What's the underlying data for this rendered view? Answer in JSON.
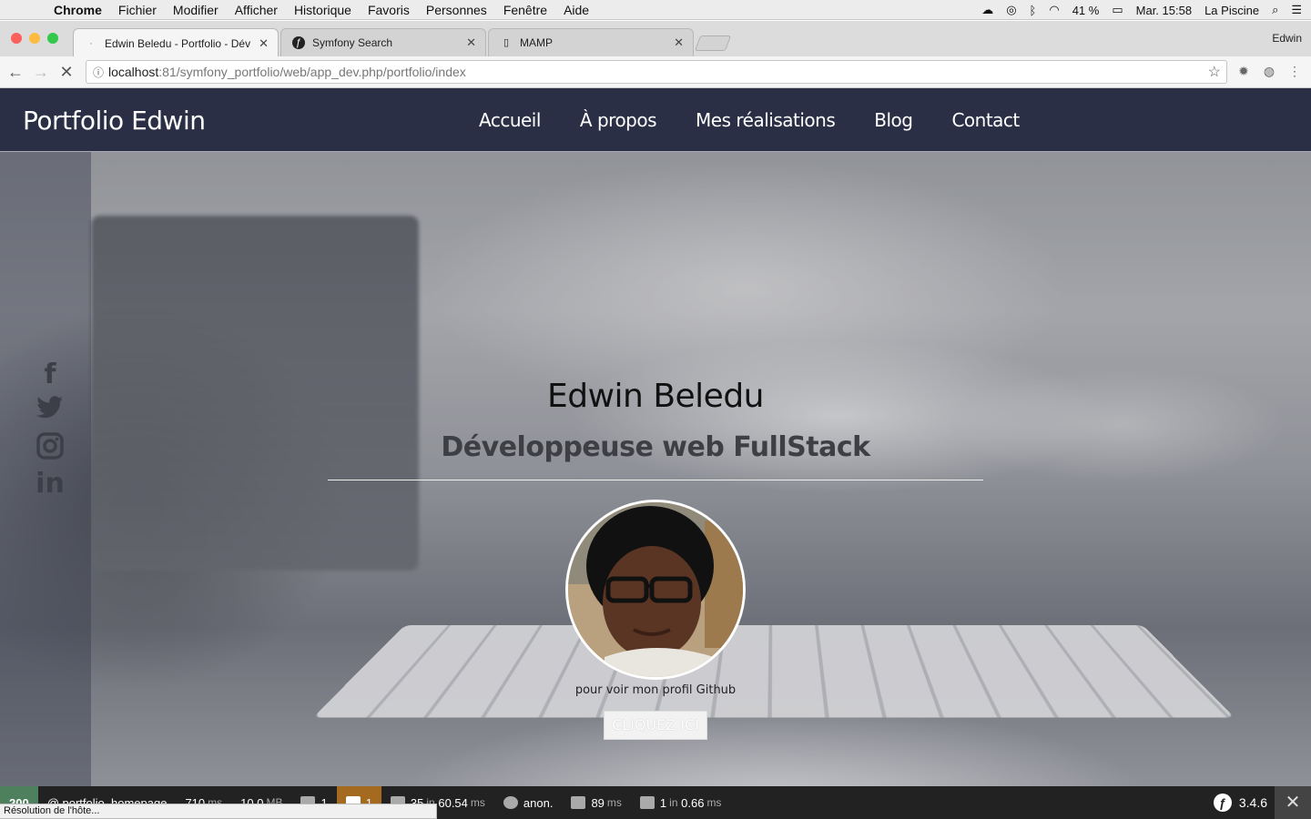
{
  "menubar": {
    "app": "Chrome",
    "items": [
      "Fichier",
      "Modifier",
      "Afficher",
      "Historique",
      "Favoris",
      "Personnes",
      "Fenêtre",
      "Aide"
    ],
    "battery": "41 %",
    "clock": "Mar. 15:58",
    "user": "La Piscine"
  },
  "tabs": [
    {
      "title": "Edwin Beledu - Portfolio - Dév"
    },
    {
      "title": "Symfony Search"
    },
    {
      "title": "MAMP"
    }
  ],
  "profile": "Edwin",
  "address": {
    "host": "localhost",
    "path": ":81/symfony_portfolio/web/app_dev.php/portfolio/index"
  },
  "site": {
    "brand": "Portfolio Edwin",
    "nav": [
      "Accueil",
      "À propos",
      "Mes réalisations",
      "Blog",
      "Contact"
    ],
    "hero": {
      "name": "Edwin Beledu",
      "role": "Développeuse web FullStack",
      "note": "pour voir mon profil Github",
      "cta": "CLIQUEZ ICI"
    },
    "social": [
      "facebook-icon",
      "twitter-icon",
      "instagram-icon",
      "linkedin-icon"
    ]
  },
  "symfony_toolbar": {
    "status": "200",
    "route": "@ portfolio_homepage",
    "time": "710",
    "time_unit": "ms",
    "memory": "10.0",
    "memory_unit": "MB",
    "forms": "1",
    "alerts": "1",
    "twig": "35",
    "twig_time": "60.54",
    "twig_unit": "ms",
    "user": "anon.",
    "render": "89",
    "render_unit": "ms",
    "db": "1",
    "db_in": "in",
    "db_time": "0.66",
    "db_unit": "ms",
    "version": "3.4.6"
  },
  "status_bubble": "Résolution de l'hôte...",
  "colors": {
    "navbar": "#2b2f46",
    "sf_status": "#4f805d",
    "sf_alert": "#a46a1f"
  }
}
